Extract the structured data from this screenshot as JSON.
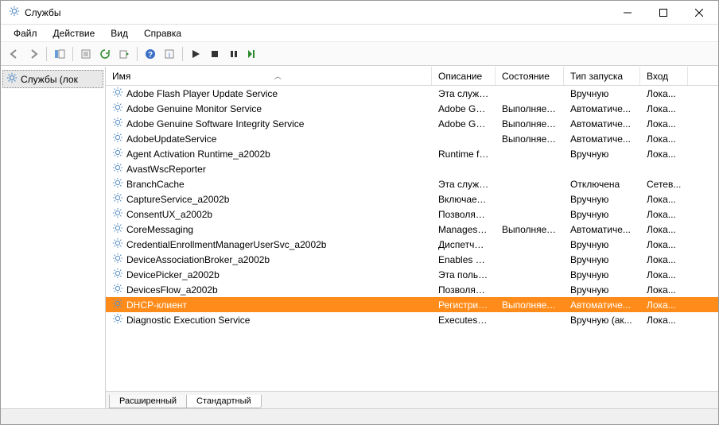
{
  "window": {
    "title": "Службы"
  },
  "menu": {
    "file": "Файл",
    "action": "Действие",
    "view": "Вид",
    "help": "Справка"
  },
  "tree": {
    "root": "Службы (лок"
  },
  "columns": {
    "name": "Имя",
    "desc": "Описание",
    "state": "Состояние",
    "start": "Тип запуска",
    "logon": "Вход"
  },
  "tabs": {
    "extended": "Расширенный",
    "standard": "Стандартный"
  },
  "services": [
    {
      "name": "Adobe Flash Player Update Service",
      "desc": "Эта служб...",
      "state": "",
      "start": "Вручную",
      "logon": "Лока..."
    },
    {
      "name": "Adobe Genuine Monitor Service",
      "desc": "Adobe Gen...",
      "state": "Выполняется",
      "start": "Автоматиче...",
      "logon": "Лока..."
    },
    {
      "name": "Adobe Genuine Software Integrity Service",
      "desc": "Adobe Gen...",
      "state": "Выполняется",
      "start": "Автоматиче...",
      "logon": "Лока..."
    },
    {
      "name": "AdobeUpdateService",
      "desc": "",
      "state": "Выполняется",
      "start": "Автоматиче...",
      "logon": "Лока..."
    },
    {
      "name": "Agent Activation Runtime_a2002b",
      "desc": "Runtime fo...",
      "state": "",
      "start": "Вручную",
      "logon": "Лока..."
    },
    {
      "name": "AvastWscReporter",
      "desc": "",
      "state": "",
      "start": "",
      "logon": ""
    },
    {
      "name": "BranchCache",
      "desc": "Эта служб...",
      "state": "",
      "start": "Отключена",
      "logon": "Сетев..."
    },
    {
      "name": "CaptureService_a2002b",
      "desc": "Включает ...",
      "state": "",
      "start": "Вручную",
      "logon": "Лока..."
    },
    {
      "name": "ConsentUX_a2002b",
      "desc": "Позволяет...",
      "state": "",
      "start": "Вручную",
      "logon": "Лока..."
    },
    {
      "name": "CoreMessaging",
      "desc": "Manages c...",
      "state": "Выполняется",
      "start": "Автоматиче...",
      "logon": "Лока..."
    },
    {
      "name": "CredentialEnrollmentManagerUserSvc_a2002b",
      "desc": "Диспетчер...",
      "state": "",
      "start": "Вручную",
      "logon": "Лока..."
    },
    {
      "name": "DeviceAssociationBroker_a2002b",
      "desc": "Enables ap...",
      "state": "",
      "start": "Вручную",
      "logon": "Лока..."
    },
    {
      "name": "DevicePicker_a2002b",
      "desc": "Эта польз...",
      "state": "",
      "start": "Вручную",
      "logon": "Лока..."
    },
    {
      "name": "DevicesFlow_a2002b",
      "desc": "Позволяет...",
      "state": "",
      "start": "Вручную",
      "logon": "Лока..."
    },
    {
      "name": "DHCP-клиент",
      "desc": "Регистрир...",
      "state": "Выполняется",
      "start": "Автоматиче...",
      "logon": "Лока...",
      "selected": true
    },
    {
      "name": "Diagnostic Execution Service",
      "desc": "Executes di...",
      "state": "",
      "start": "Вручную (ак...",
      "logon": "Лока..."
    }
  ]
}
